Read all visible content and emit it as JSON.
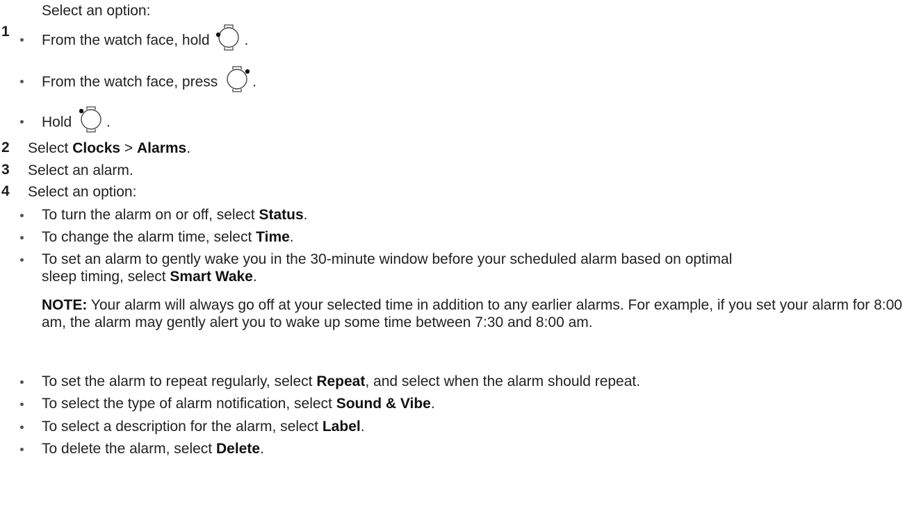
{
  "step1": {
    "number": "1",
    "text": "Select an option:",
    "options": [
      {
        "prefix": "From the watch face, hold",
        "icon": "watch-button-left-icon",
        "suffix": "."
      },
      {
        "prefix": "From the watch face, press",
        "icon": "watch-button-right-icon",
        "suffix": "."
      },
      {
        "prefix": "Hold",
        "icon": "watch-button-top-left-icon",
        "suffix": "."
      }
    ]
  },
  "step2": {
    "number": "2",
    "pre": "Select ",
    "b1": "Clocks",
    "mid": " > ",
    "b2": "Alarms",
    "post": "."
  },
  "step3": {
    "number": "3",
    "text": "Select an alarm."
  },
  "step4": {
    "number": "4",
    "text": "Select an option:",
    "options": [
      {
        "pre": "To turn the alarm on or off, select ",
        "bold": "Status",
        "post": "."
      },
      {
        "pre": "To change the alarm time, select ",
        "bold": "Time",
        "post": "."
      },
      {
        "pre": "To set an alarm to gently wake you in the 30-minute window before your scheduled alarm based on optimal sleep timing, select ",
        "bold": "Smart Wake",
        "post": "."
      },
      {
        "pre": "To set the alarm to repeat regularly, select ",
        "bold": "Repeat",
        "post": ", and select when the alarm should repeat."
      },
      {
        "pre": "To select the type of alarm notification, select ",
        "bold": "Sound & Vibe",
        "post": "."
      },
      {
        "pre": "To select a description for the alarm, select ",
        "bold": "Label",
        "post": "."
      },
      {
        "pre": "To delete the alarm, select ",
        "bold": "Delete",
        "post": "."
      }
    ],
    "note": {
      "label": "NOTE:",
      "text": " Your alarm will always go off at your selected time in addition to any earlier alarms. For example, if you set your alarm for 8:00 am, the alarm may gently alert you to wake up some time between 7:30 and 8:00 am."
    }
  },
  "colors": {
    "text": "#222222",
    "bullet": "#555555",
    "background": "#ffffff"
  }
}
